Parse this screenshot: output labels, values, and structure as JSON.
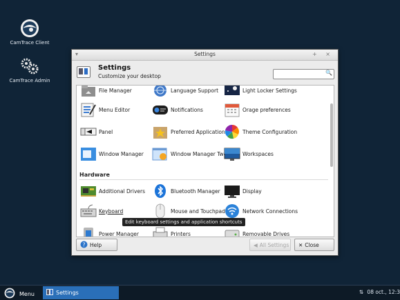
{
  "desktop": {
    "icons": [
      {
        "label": "CamTrace Client",
        "icon": "camtrace-logo-icon"
      },
      {
        "label": "CamTrace Admin",
        "icon": "gears-icon"
      }
    ]
  },
  "window": {
    "title": "Settings",
    "menu_glyph": "▾",
    "controls": "+ ×",
    "header_title": "Settings",
    "header_subtitle": "Customize your desktop",
    "search_value": "",
    "search_icon": "🔍",
    "items_personal": [
      {
        "label": "File Manager",
        "icon": "file-manager-icon"
      },
      {
        "label": "Language Support",
        "icon": "language-icon"
      },
      {
        "label": "Light Locker Settings",
        "icon": "lock-screen-icon"
      },
      {
        "label": "Menu Editor",
        "icon": "menu-editor-icon"
      },
      {
        "label": "Notifications",
        "icon": "notifications-icon"
      },
      {
        "label": "Orage preferences",
        "icon": "calendar-icon"
      },
      {
        "label": "Panel",
        "icon": "panel-icon"
      },
      {
        "label": "Preferred Applications",
        "icon": "preferred-apps-icon"
      },
      {
        "label": "Theme Configuration",
        "icon": "theme-icon"
      },
      {
        "label": "Window Manager",
        "icon": "window-manager-icon"
      },
      {
        "label": "Window Manager Tweaks",
        "icon": "wm-tweaks-icon"
      },
      {
        "label": "Workspaces",
        "icon": "workspaces-icon"
      }
    ],
    "section_hardware": "Hardware",
    "items_hardware": [
      {
        "label": "Additional Drivers",
        "icon": "drivers-icon"
      },
      {
        "label": "Bluetooth Manager",
        "icon": "bluetooth-icon"
      },
      {
        "label": "Display",
        "icon": "display-icon"
      },
      {
        "label": "Keyboard",
        "icon": "keyboard-icon"
      },
      {
        "label": "Mouse and Touchpad",
        "icon": "mouse-icon"
      },
      {
        "label": "Network Connections",
        "icon": "network-icon"
      },
      {
        "label": "Power Manager",
        "icon": "power-icon"
      },
      {
        "label": "Printers",
        "icon": "printer-icon"
      },
      {
        "label": "Removable Drives",
        "icon": "removable-drive-icon"
      }
    ],
    "tooltip": "Edit keyboard settings and application shortcuts",
    "help_label": "Help",
    "all_settings_label": "All Settings",
    "close_label": "Close"
  },
  "taskbar": {
    "menu_label": "Menu",
    "task_label": "Settings",
    "clock": "08 oct., 12:3",
    "net_glyph": "⇅"
  }
}
